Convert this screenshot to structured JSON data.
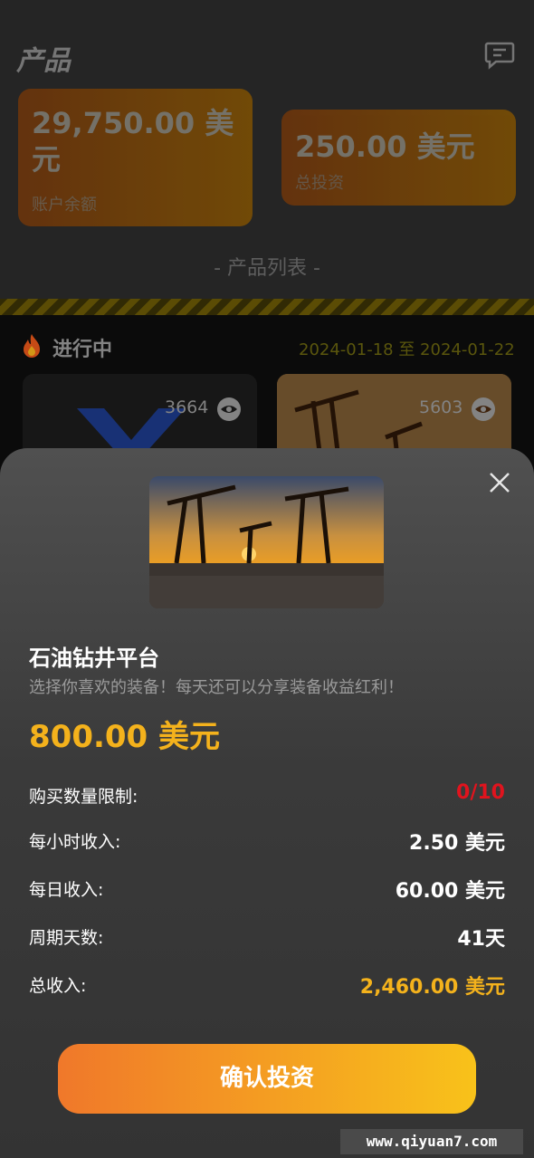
{
  "header": {
    "title": "产品",
    "message_icon": "message-square-icon"
  },
  "summary": {
    "balance_amount": "29,750.00 美元",
    "balance_label": "账户余额",
    "invest_amount": "250.00 美元",
    "invest_label": "总投资"
  },
  "list_title": "- 产品列表 -",
  "section": {
    "icon": "fire-icon",
    "label": "进行中",
    "date_range": "2024-01-18 至 2024-01-22"
  },
  "products": [
    {
      "views": "3664"
    },
    {
      "views": "5603"
    }
  ],
  "sheet": {
    "name": "石油钻井平台",
    "description": "选择你喜欢的装备！每天还可以分享装备收益红利！",
    "price": "800.00 美元",
    "rows": [
      {
        "label": "购买数量限制:",
        "value": "0/10"
      },
      {
        "label": "每小时收入:",
        "value": "2.50 美元"
      },
      {
        "label": "每日收入:",
        "value": "60.00 美元"
      },
      {
        "label": "周期天数:",
        "value": "41天"
      },
      {
        "label": "总收入:",
        "value": "2,460.00 美元"
      }
    ],
    "confirm_label": "确认投资"
  },
  "watermark": "www.qiyuan7.com",
  "colors": {
    "accent": "#f4b21c",
    "limit": "#e0141e",
    "button_start": "#f0782a",
    "button_end": "#f8c21a"
  }
}
